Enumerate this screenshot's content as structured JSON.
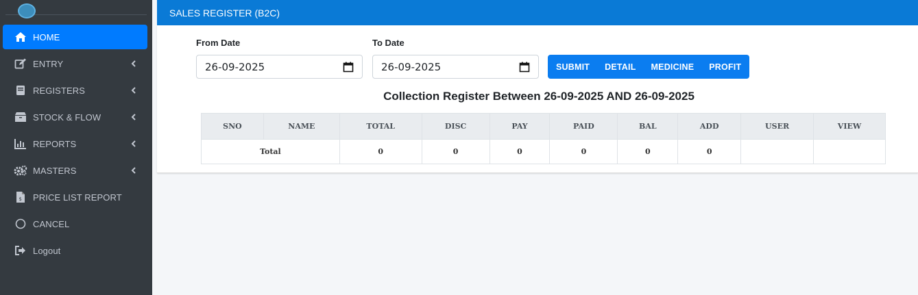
{
  "sidebar": {
    "items": [
      {
        "label": "HOME",
        "icon": "home-icon",
        "active": true,
        "has_chevron": false
      },
      {
        "label": "ENTRY",
        "icon": "edit-icon",
        "active": false,
        "has_chevron": true
      },
      {
        "label": "REGISTERS",
        "icon": "book-icon",
        "active": false,
        "has_chevron": true
      },
      {
        "label": "STOCK & FLOW",
        "icon": "box-icon",
        "active": false,
        "has_chevron": true
      },
      {
        "label": "REPORTS",
        "icon": "bar-chart-icon",
        "active": false,
        "has_chevron": true
      },
      {
        "label": "MASTERS",
        "icon": "gears-icon",
        "active": false,
        "has_chevron": true
      },
      {
        "label": "PRICE LIST REPORT",
        "icon": "invoice-icon",
        "active": false,
        "has_chevron": false
      },
      {
        "label": "CANCEL",
        "icon": "circle-icon",
        "active": false,
        "has_chevron": false
      },
      {
        "label": "Logout",
        "icon": "logout-icon",
        "active": false,
        "has_chevron": false
      }
    ]
  },
  "header": {
    "title": "SALES REGISTER (B2C)"
  },
  "form": {
    "from_label": "From Date",
    "from_value": "26-09-2025",
    "to_label": "To Date",
    "to_value": "26-09-2025",
    "buttons": [
      "SUBMIT",
      "DETAIL",
      "MEDICINE",
      "PROFIT"
    ]
  },
  "report": {
    "title": "Collection Register Between 26-09-2025 AND 26-09-2025"
  },
  "table": {
    "columns": [
      "SNO",
      "NAME",
      "TOTAL",
      "DISC",
      "PAY",
      "PAID",
      "BAL",
      "ADD",
      "USER",
      "VIEW"
    ],
    "total_row": {
      "label": "Total",
      "values": [
        "0",
        "0",
        "0",
        "0",
        "0",
        "0"
      ],
      "user": "",
      "view": ""
    }
  },
  "colors": {
    "sidebar_bg": "#343a40",
    "accent": "#007bff",
    "header_bg": "#0a7ad6",
    "page_bg": "#f4f6f9"
  }
}
